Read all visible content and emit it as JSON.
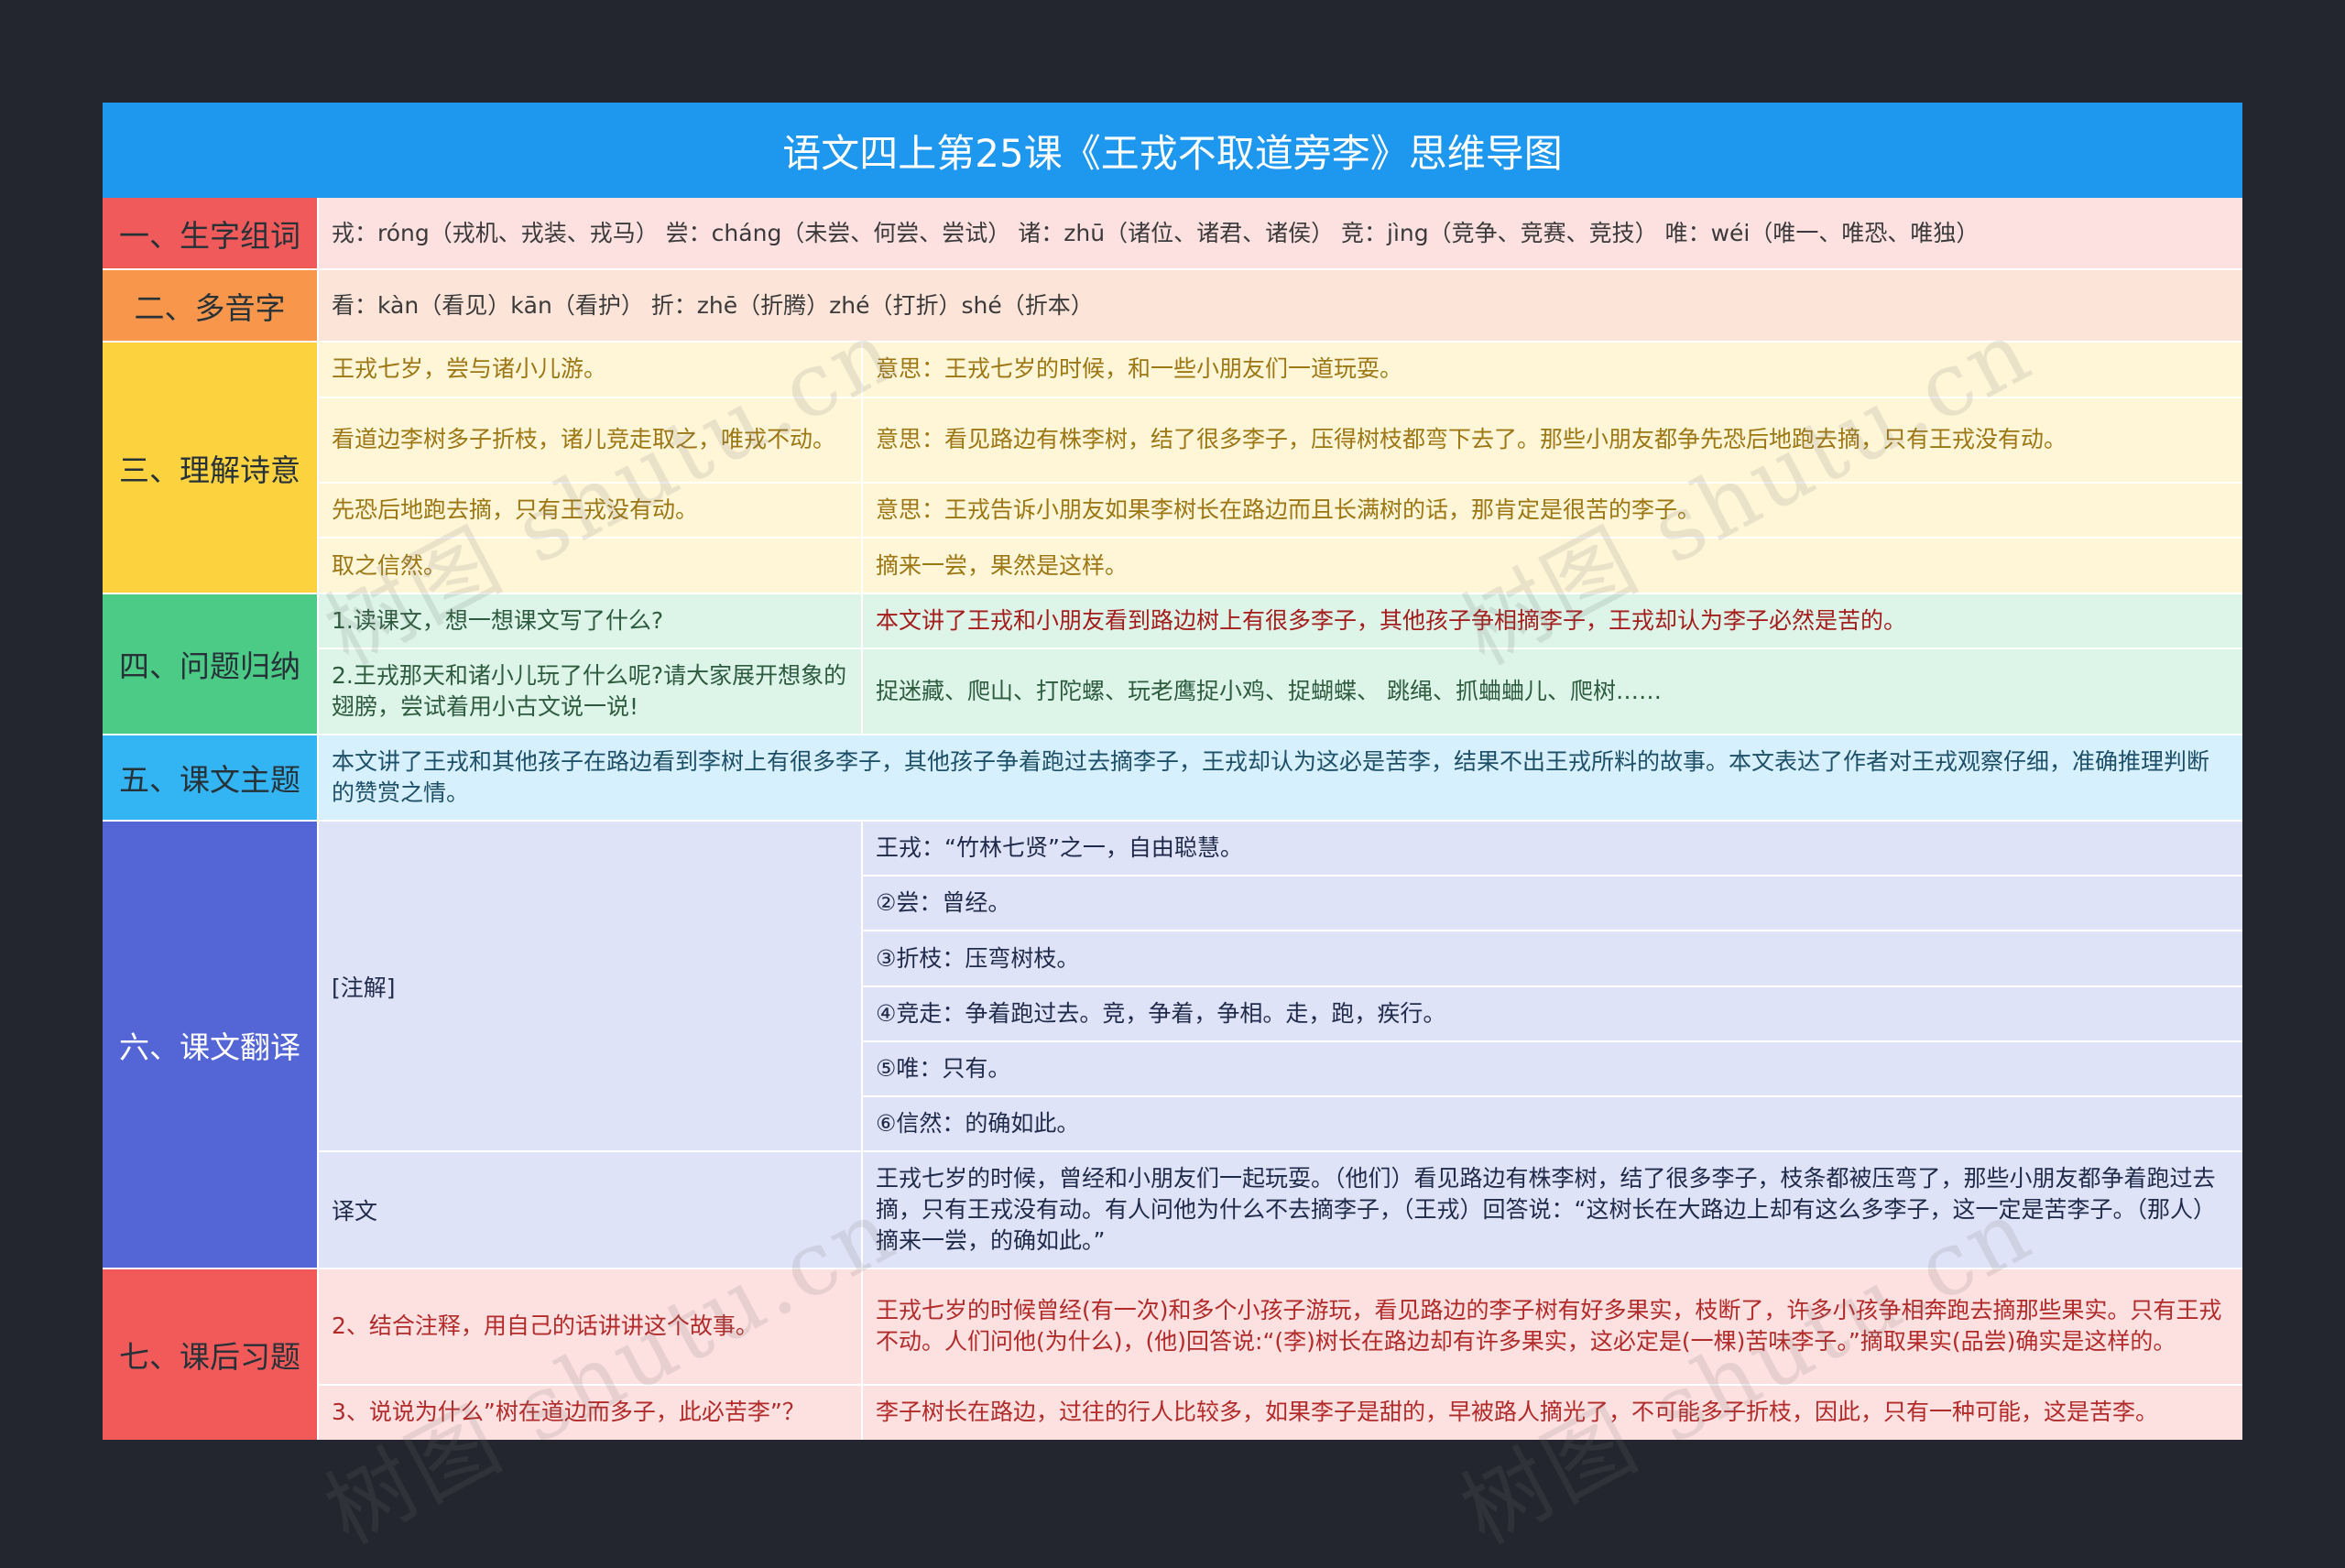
{
  "title": "语文四上第25课《王戎不取道旁李》思维导图",
  "sections": {
    "s1": {
      "label": "一、生字组词",
      "text": "戎：róng（戎机、戎装、戎马） 尝：cháng（未尝、何尝、尝试） 诸：zhū（诸位、诸君、诸侯） 竞：jìng（竞争、竞赛、竞技） 唯：wéi（唯一、唯恐、唯独）"
    },
    "s2": {
      "label": "二、多音字",
      "text": "看：kàn（看见）kān（看护） 折：zhē（折腾）zhé（打折）shé（折本）"
    },
    "s3": {
      "label": "三、理解诗意",
      "rows": [
        {
          "left": "王戎七岁，尝与诸小儿游。",
          "right": "意思：王戎七岁的时候，和一些小朋友们一道玩耍。"
        },
        {
          "left": "看道边李树多子折枝，诸儿竞走取之，唯戎不动。",
          "right": "意思：看见路边有株李树，结了很多李子，压得树枝都弯下去了。那些小朋友都争先恐后地跑去摘，只有王戎没有动。"
        },
        {
          "left": "先恐后地跑去摘，只有王戎没有动。",
          "right": "意思：王戎告诉小朋友如果李树长在路边而且长满树的话，那肯定是很苦的李子。"
        },
        {
          "left": "取之信然。",
          "right": "摘来一尝，果然是这样。"
        }
      ]
    },
    "s4": {
      "label": "四、问题归纳",
      "rows": [
        {
          "left": "1.读课文，想一想课文写了什么?",
          "right": "本文讲了王戎和小朋友看到路边树上有很多李子，其他孩子争相摘李子，王戎却认为李子必然是苦的。"
        },
        {
          "left": "2.王戎那天和诸小儿玩了什么呢?请大家展开想象的翅膀，尝试着用小古文说一说!",
          "right": "捉迷藏、爬山、打陀螺、玩老鹰捉小鸡、捉蝴蝶、 跳绳、抓蛐蛐儿、爬树……"
        }
      ]
    },
    "s5": {
      "label": "五、课文主题",
      "text": "本文讲了王戎和其他孩子在路边看到李树上有很多李子，其他孩子争着跑过去摘李子，王戎却认为这必是苦李，结果不出王戎所料的故事。本文表达了作者对王戎观察仔细，准确推理判断的赞赏之情。"
    },
    "s6": {
      "label": "六、课文翻译",
      "notes_label": "[注解]",
      "notes": [
        "王戎：“竹林七贤”之一，自由聪慧。",
        "②尝：曾经。",
        "③折枝：压弯树枝。",
        "④竞走：争着跑过去。竞，争着，争相。走，跑，疾行。",
        "⑤唯：只有。",
        "⑥信然：的确如此。"
      ],
      "translation_label": "译文",
      "translation": "王戎七岁的时候，曾经和小朋友们一起玩耍。（他们）看见路边有株李树，结了很多李子，枝条都被压弯了，那些小朋友都争着跑过去摘，只有王戎没有动。有人问他为什么不去摘李子，（王戎）回答说：“这树长在大路边上却有这么多李子，这一定是苦李子。（那人）摘来一尝，的确如此。”"
    },
    "s7": {
      "label": "七、课后习题",
      "rows": [
        {
          "left": "2、结合注释，用自己的话讲讲这个故事。",
          "right": "王戎七岁的时候曾经(有一次)和多个小孩子游玩，看见路边的李子树有好多果实，枝断了，许多小孩争相奔跑去摘那些果实。只有王戎不动。人们问他(为什么)，(他)回答说:“(李)树长在路边却有许多果实，这必定是(一棵)苦味李子。”摘取果实(品尝)确实是这样的。"
        },
        {
          "left": "3、说说为什么”树在道边而多子，此必苦李”？",
          "right": "李子树长在路边，过往的行人比较多，如果李子是甜的，早被路人摘光了，不可能多子折枝，因此，只有一种可能，这是苦李。"
        }
      ]
    }
  },
  "watermark": "树图 shutu.cn"
}
